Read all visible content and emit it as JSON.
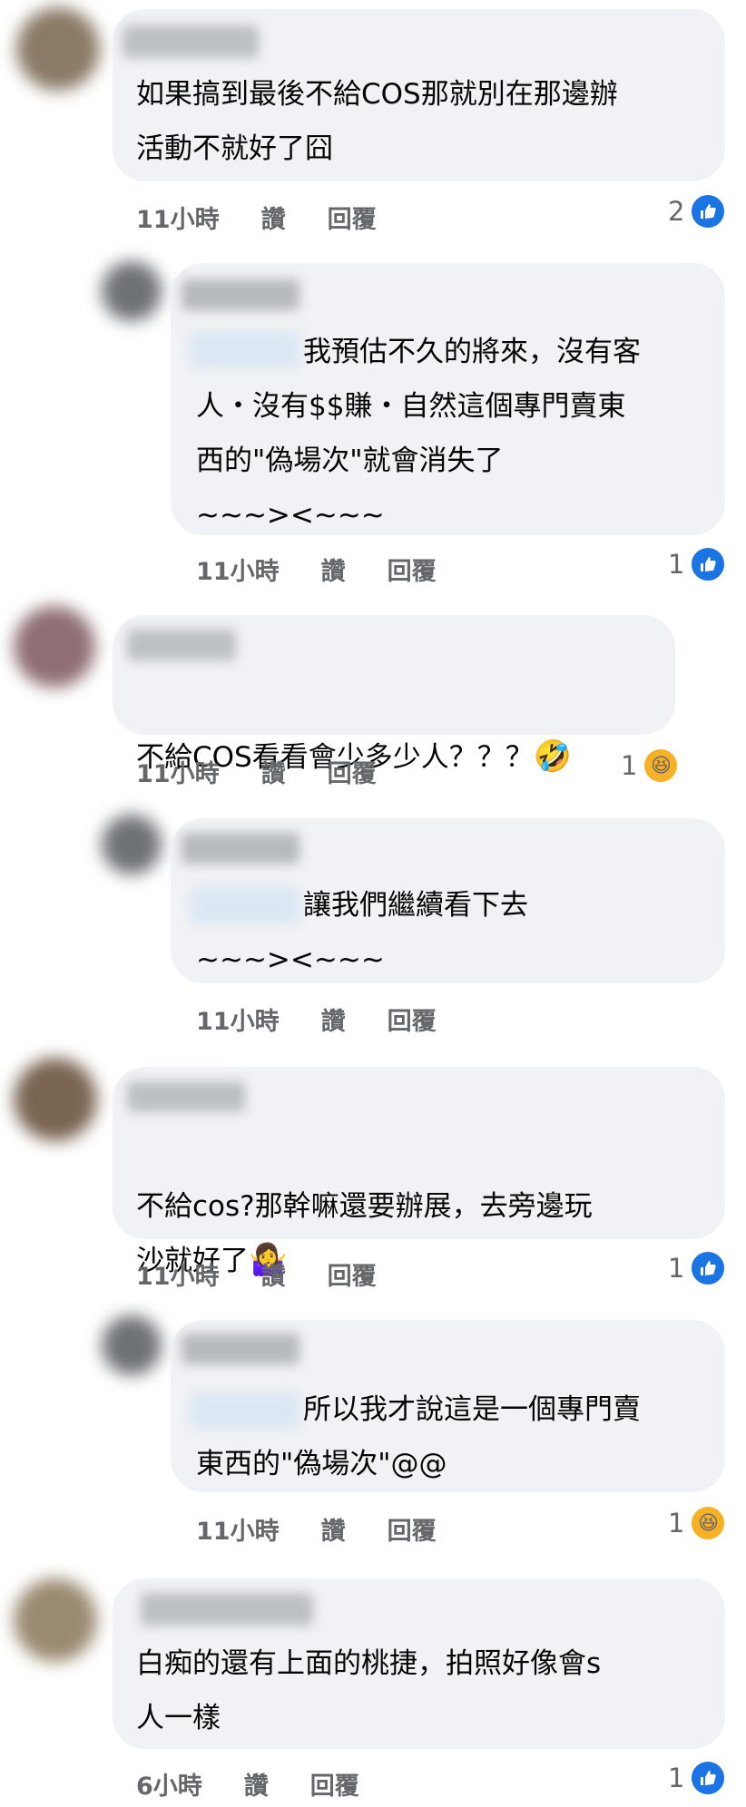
{
  "comments": [
    {
      "text": "如果搞到最後不給COS那就別在那邊辦\n活動不就好了囧",
      "time": "11小時",
      "like": "讚",
      "reply": "回覆",
      "reaction_count": "2",
      "reaction": "like-icon"
    },
    {
      "text": "我預估不久的將來，沒有客\n人・沒有$$賺・自然這個專門賣東\n西的\"偽場次\"就會消失了\n~~~><~~~",
      "time": "11小時",
      "like": "讚",
      "reply": "回覆",
      "reaction_count": "1",
      "reaction": "like-icon"
    },
    {
      "text": "不給COS看看會少多少人？？？",
      "emoji": "🤣",
      "time": "11小時",
      "like": "讚",
      "reply": "回覆",
      "reaction_count": "1",
      "reaction": "haha-icon"
    },
    {
      "text": "讓我們繼續看下去\n~~~><~~~",
      "time": "11小時",
      "like": "讚",
      "reply": "回覆"
    },
    {
      "text": "不給cos?那幹嘛還要辦展，去旁邊玩\n沙就好了",
      "emoji": "🤷‍♀️",
      "time": "11小時",
      "like": "讚",
      "reply": "回覆",
      "reaction_count": "1",
      "reaction": "like-icon"
    },
    {
      "text": "所以我才說這是一個專門賣\n東西的\"偽場次\"@@",
      "time": "11小時",
      "like": "讚",
      "reply": "回覆",
      "reaction_count": "1",
      "reaction": "haha-icon"
    },
    {
      "text": "白痴的還有上面的桃捷，拍照好像會s\n人一樣",
      "time": "6小時",
      "like": "讚",
      "reply": "回覆",
      "reaction_count": "1",
      "reaction": "like-icon"
    }
  ],
  "colors": {
    "bubble": "#f0f2f5",
    "meta": "#65676b",
    "like": "#1b74e4",
    "haha": "#f7b125"
  }
}
